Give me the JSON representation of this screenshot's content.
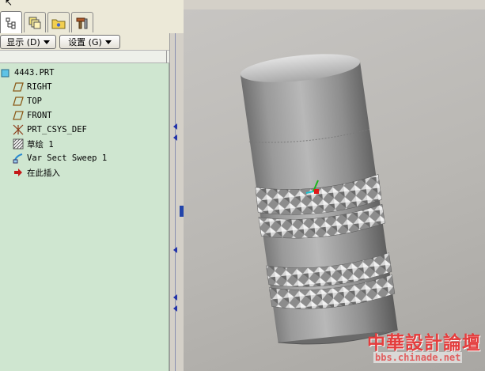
{
  "tabs": [
    {
      "name": "model-tree-tab",
      "icon": "model-tree-icon",
      "active": true
    },
    {
      "name": "layers-tab",
      "icon": "layers-icon"
    },
    {
      "name": "folder-browser-tab",
      "icon": "folder-icon"
    },
    {
      "name": "tools-tab",
      "icon": "tools-icon"
    }
  ],
  "toolbar": {
    "show_label": "显示 (D)",
    "settings_label": "设置 (G)"
  },
  "tree": {
    "root": "4443.PRT",
    "items": [
      {
        "label": "RIGHT",
        "icon": "datum-plane-icon"
      },
      {
        "label": "TOP",
        "icon": "datum-plane-icon"
      },
      {
        "label": "FRONT",
        "icon": "datum-plane-icon"
      },
      {
        "label": "PRT_CSYS_DEF",
        "icon": "coordinate-system-icon"
      },
      {
        "label": "草绘 1",
        "icon": "sketch-icon"
      },
      {
        "label": "Var Sect Sweep 1",
        "icon": "sweep-icon"
      },
      {
        "label": "在此插入",
        "icon": "insert-here-arrow-icon"
      }
    ]
  },
  "watermark": {
    "title": "中華設計論壇",
    "url": "bbs.chinade.net"
  },
  "colors": {
    "tree_bg": "#cfe6d0",
    "viewport_bg": "#bdbbb7",
    "accent": "#2244aa",
    "watermark": "#e43d3d"
  }
}
